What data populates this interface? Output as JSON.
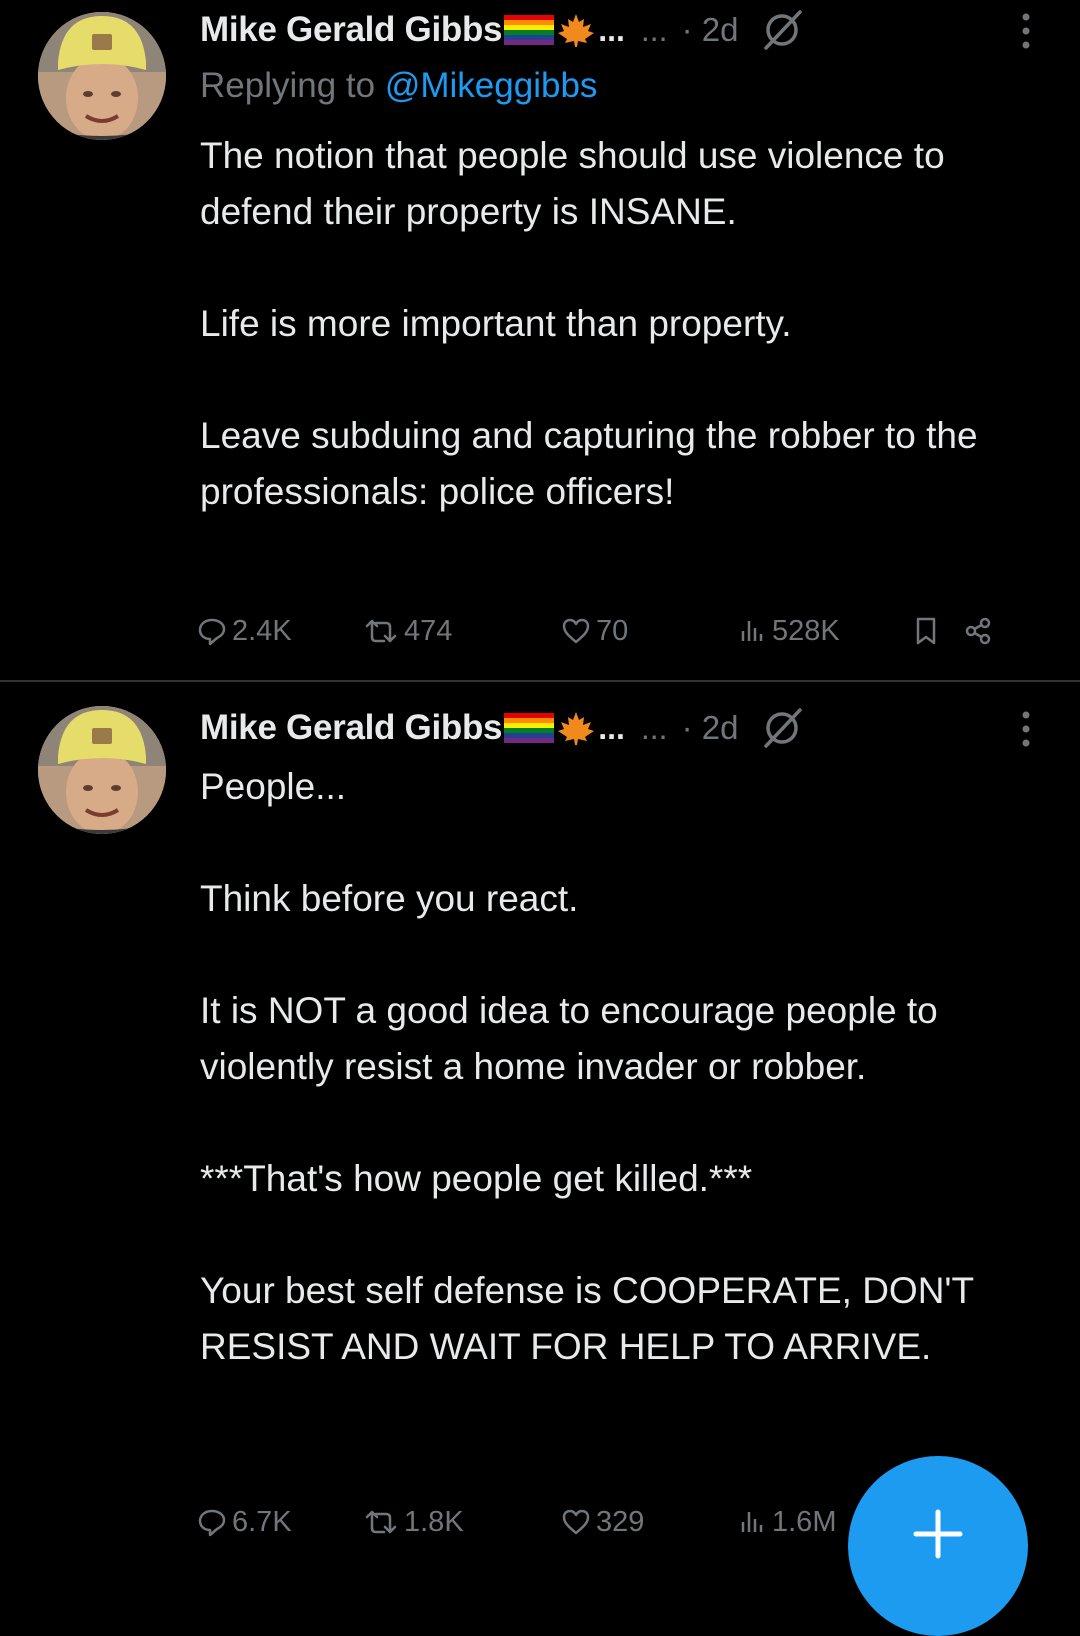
{
  "tweets": [
    {
      "author": {
        "name": "Mike Gerald Gibbs",
        "name_suffix": "...",
        "handle_truncated": "...",
        "avatar": "profile-photo-avatar",
        "badges": [
          "rainbow-flag-icon",
          "maple-leaf-icon"
        ]
      },
      "time": "· 2d",
      "replying_prefix": "Replying to",
      "replying_handle": "@Mikeggibbs",
      "paragraphs": [
        "The notion that people should use violence to defend their property is INSANE.",
        "Life is more important than property.",
        "Leave subduing and capturing the robber to the professionals: police officers!"
      ],
      "stats": {
        "replies": "2.4K",
        "reposts": "474",
        "likes": "70",
        "views": "528K"
      }
    },
    {
      "author": {
        "name": "Mike Gerald Gibbs",
        "name_suffix": "...",
        "handle_truncated": "...",
        "avatar": "profile-photo-avatar",
        "badges": [
          "rainbow-flag-icon",
          "maple-leaf-icon"
        ]
      },
      "time": "· 2d",
      "paragraphs": [
        "People...",
        "Think before you react.",
        "It is NOT a good idea to encourage people to violently resist a home invader or robber.",
        "***That's how people get killed.***",
        "Your best self defense is COOPERATE, DON'T RESIST AND WAIT FOR HELP TO ARRIVE."
      ],
      "stats": {
        "replies": "6.7K",
        "reposts": "1.8K",
        "likes": "329",
        "views": "1.6M"
      }
    }
  ],
  "icons": {
    "reply": "reply-bubble-icon",
    "repost": "repost-icon",
    "like": "heart-icon",
    "views": "views-bar-chart-icon",
    "bookmark": "bookmark-icon",
    "share": "share-icon",
    "grok": "grok-icon",
    "more": "more-vertical-icon",
    "compose": "plus-icon"
  },
  "colors": {
    "background": "#000000",
    "text": "#e7e9ea",
    "muted": "#71767b",
    "accent": "#1d9bf0",
    "divider": "#2f3336"
  }
}
